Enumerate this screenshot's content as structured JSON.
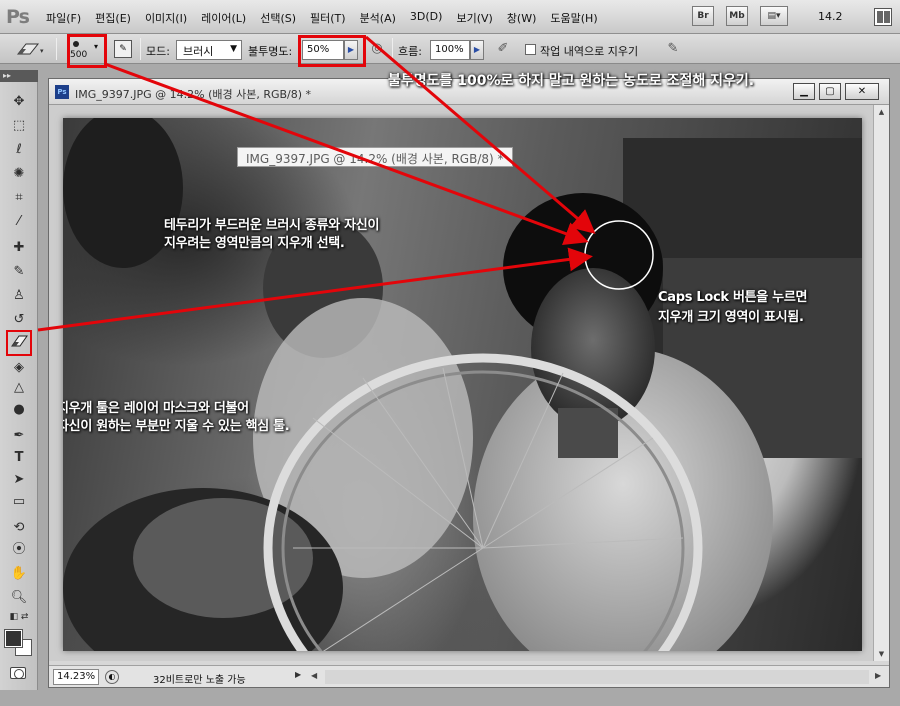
{
  "app": {
    "logo": "Ps",
    "menu": [
      "파일(F)",
      "편집(E)",
      "이미지(I)",
      "레이어(L)",
      "선택(S)",
      "필터(T)",
      "분석(A)",
      "3D(D)",
      "보기(V)",
      "창(W)",
      "도움말(H)"
    ],
    "bridge_label": "Br",
    "minibridge_label": "Mb",
    "zoom": "14.2"
  },
  "options": {
    "brush_size": "500",
    "mode_label": "모드:",
    "mode_value": "브러시",
    "opacity_label": "불투명도:",
    "opacity_value": "50%",
    "flow_label": "흐름:",
    "flow_value": "100%",
    "erase_history_label": "작업 내역으로 지우기"
  },
  "document": {
    "title": "IMG_9397.JPG @ 14.2% (배경 사본, RGB/8) *",
    "tooltip": "IMG_9397.JPG @ 14.2% (배경 사본, RGB/8) *",
    "status_zoom": "14.23%",
    "status_text": "32비트로만 노출 가능"
  },
  "annotations": {
    "top": "불투명도를 100%로 하지 말고 원하는 농도로 조절해 지우기.",
    "brush_line1": "테두리가 부드러운 브러시 종류와 자신이",
    "brush_line2": "지우려는 영역만큼의 지우개 선택.",
    "caps_line1": "Caps Lock 버튼을 누르면",
    "caps_line2": "지우개 크기 영역이 표시됨.",
    "eraser_line1": "지우개 툴은 레이어 마스크와 더불어",
    "eraser_line2": "자신이 원하는 부분만 지울 수 있는 핵심 툴."
  },
  "colors": {
    "callout_red": "#e3050a"
  }
}
